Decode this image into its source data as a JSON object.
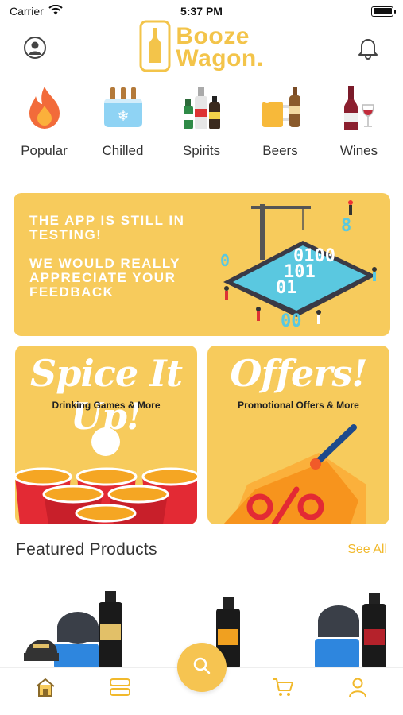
{
  "status_bar": {
    "carrier": "Carrier",
    "time": "5:37 PM"
  },
  "header": {
    "logo_line1": "Booze",
    "logo_line2": "Wagon.",
    "profile_icon": "user-circle-icon",
    "notification_icon": "bell-icon"
  },
  "categories": [
    {
      "label": "Popular",
      "icon": "flame-icon"
    },
    {
      "label": "Chilled",
      "icon": "ice-bucket-icon"
    },
    {
      "label": "Spirits",
      "icon": "spirits-bottles-icon"
    },
    {
      "label": "Beers",
      "icon": "beer-mug-icon"
    },
    {
      "label": "Wines",
      "icon": "wine-bottle-icon"
    }
  ],
  "banner": {
    "line1": "THE APP IS STILL IN TESTING!",
    "line2": "WE WOULD REALLY APPRECIATE YOUR FEEDBACK"
  },
  "promo_cards": [
    {
      "title": "Spice It Up!",
      "subtitle": "Drinking Games & More"
    },
    {
      "title": "Offers!",
      "subtitle": "Promotional Offers & More"
    }
  ],
  "featured": {
    "title": "Featured Products",
    "see_all": "See All"
  },
  "tabbar": {
    "items": [
      "home-icon",
      "categories-icon",
      "search-icon",
      "cart-icon",
      "account-icon"
    ]
  },
  "colors": {
    "accent": "#f6c451",
    "banner": "#f7cb5c",
    "see_all": "#f1b92c"
  }
}
